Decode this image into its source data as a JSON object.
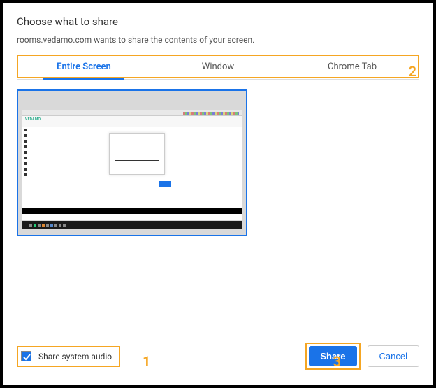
{
  "dialog": {
    "title": "Choose what to share",
    "subtitle": "rooms.vedamo.com wants to share the contents of your screen."
  },
  "tabs": [
    {
      "label": "Entire Screen",
      "active": true
    },
    {
      "label": "Window",
      "active": false
    },
    {
      "label": "Chrome Tab",
      "active": false
    }
  ],
  "thumbnail": {
    "logo_text": "VEDAMO"
  },
  "footer": {
    "checkbox_label": "Share system audio",
    "checkbox_checked": true,
    "share_label": "Share",
    "cancel_label": "Cancel"
  },
  "annotations": {
    "a1": "1",
    "a2": "2",
    "a3": "3"
  },
  "colors": {
    "accent": "#1a73e8",
    "highlight": "#f5a623"
  }
}
